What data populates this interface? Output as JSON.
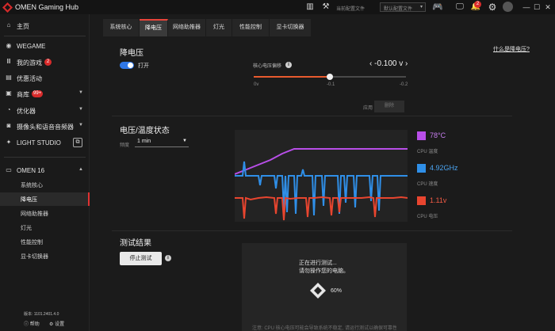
{
  "app": {
    "title": "OMEN Gaming Hub"
  },
  "toolbar": {
    "config_text": "当前配置文件",
    "dropdown_text": "默认配置文件",
    "notification_count": "2"
  },
  "sidebar": {
    "items": [
      {
        "label": "主页",
        "icon": "home-icon"
      },
      {
        "label": "WEGAME",
        "icon": "wegame-icon"
      },
      {
        "label": "我的游戏",
        "icon": "library-icon",
        "badge": "2"
      },
      {
        "label": "优惠活动",
        "icon": "promotion-icon"
      },
      {
        "label": "商库",
        "icon": "store-icon",
        "badge": "99+"
      },
      {
        "label": "优化器",
        "icon": "optimizer-icon"
      },
      {
        "label": "摄像头和语音音频器",
        "icon": "camera-icon"
      },
      {
        "label": "LIGHT STUDIO",
        "icon": "light-studio-icon"
      }
    ],
    "device": "OMEN 16",
    "sub_items": [
      "系统核心",
      "降电压",
      "网络助推器",
      "灯光",
      "性能控制",
      "显卡切换器"
    ],
    "version": "版本: 1101.2401.4.0",
    "bottom_links": [
      "帮助",
      "设置"
    ]
  },
  "tabs": [
    "系统核心",
    "降电压",
    "网络助推器",
    "灯光",
    "性能控制",
    "显卡切换器"
  ],
  "undervolt": {
    "title": "降电压",
    "what_link": "什么是降电压?",
    "toggle_label": "打开",
    "offset_label": "核心电压偏移",
    "offset_value": "-0.100 v",
    "slider_ticks": [
      "0v",
      "-0.1",
      "-0.2"
    ],
    "slider_fraction": 0.5,
    "small_label": "应用",
    "apply_button": "删除"
  },
  "status": {
    "title": "电压/温度状态",
    "freq_label": "频度",
    "freq_value": "1 min",
    "legend": [
      {
        "value": "78°C",
        "label": "CPU 温度",
        "color": "#b84ee8"
      },
      {
        "value": "4.92GHz",
        "label": "CPU 速度",
        "color": "#2f8fe8"
      },
      {
        "value": "1.11v",
        "label": "CPU 电压",
        "color": "#e8452f"
      }
    ]
  },
  "test": {
    "title": "测试结果",
    "stop_button": "停止测试",
    "running_line1": "正在进行测试...",
    "running_line2": "请勿操作您的电脑。",
    "progress_text": "60%",
    "progress": 0.6,
    "footer_note": "注意: CPU 核心电压可能会导致系统不稳定, 请运行测试以确保可靠性。"
  }
}
